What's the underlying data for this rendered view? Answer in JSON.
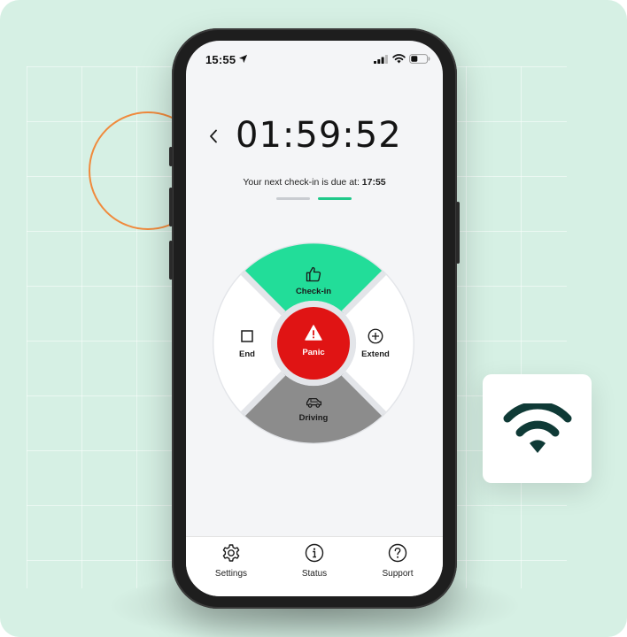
{
  "status_bar": {
    "time": "15:55",
    "icons": [
      "location-arrow-icon",
      "signal-icon",
      "wifi-icon",
      "battery-icon"
    ]
  },
  "timer": {
    "value": "01:59:52",
    "next_checkin_prefix": "Your next check-in is due at: ",
    "next_checkin_time": "17:55"
  },
  "progress": {
    "steps": 2,
    "active_step": 2,
    "inactive_color": "#c9ccd1",
    "active_color": "#1fc98a"
  },
  "wheel": {
    "top": {
      "label": "Check-in",
      "icon": "thumbs-up-icon",
      "color": "#22dd99"
    },
    "left": {
      "label": "End",
      "icon": "stop-square-icon",
      "color": "#ffffff"
    },
    "right": {
      "label": "Extend",
      "icon": "plus-circle-icon",
      "color": "#ffffff"
    },
    "bottom": {
      "label": "Driving",
      "icon": "car-icon",
      "color": "#8c8c8c"
    },
    "center": {
      "label": "Panic",
      "icon": "warning-icon",
      "color": "#e01414"
    }
  },
  "tabbar": {
    "items": [
      {
        "label": "Settings",
        "icon": "gear-icon"
      },
      {
        "label": "Status",
        "icon": "info-icon"
      },
      {
        "label": "Support",
        "icon": "question-icon"
      }
    ]
  },
  "colors": {
    "background": "#d6f0e4",
    "accent_ring": "#f08a3c",
    "wifi_card_icon": "#0f3a36"
  }
}
